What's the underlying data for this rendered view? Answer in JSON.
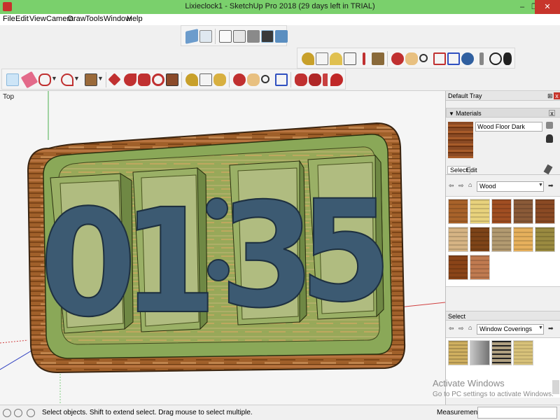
{
  "window": {
    "title": "Lixieclock1 - SketchUp Pro 2018 (29 days left in TRIAL)",
    "minimize": "–",
    "restore": "❐",
    "close": "✕"
  },
  "menu": [
    "File",
    "Edit",
    "View",
    "Camera",
    "Draw",
    "Tools",
    "Window",
    "Help"
  ],
  "viewport": {
    "view_label": "Top",
    "model_digits": [
      "0",
      "1",
      ":",
      "3",
      "5"
    ]
  },
  "tray": {
    "title": "Default Tray",
    "pin": "⊞",
    "close": "x",
    "materials": {
      "header": "Materials",
      "current_material": "Wood Floor Dark",
      "tabs": [
        "Select",
        "Edit"
      ],
      "library": "Wood",
      "swatch_colors": [
        "#a8622a",
        "#e8d27c",
        "#a04e22",
        "#8a5a38",
        "#8a4a24",
        "#d6b484",
        "#7e4418",
        "#b29a70",
        "#e6b05c",
        "#9a8a40",
        "#8a4418",
        "#c07a50"
      ]
    },
    "secondary": {
      "header": "Select",
      "library": "Window Coverings",
      "swatch_colors": [
        "#d0b060",
        "#909090",
        "#b0a080",
        "#d8c27a"
      ]
    }
  },
  "status": {
    "hint": "Select objects. Shift to extend select. Drag mouse to select multiple.",
    "measurements_label": "Measurements"
  },
  "watermark": {
    "title": "Activate Windows",
    "subtitle": "Go to PC settings to activate Windows."
  },
  "colors": {
    "titlebar": "#7ad06c",
    "model_green": "#8aa858",
    "digit_blue": "#3c5a72",
    "wood": "#a0602a"
  }
}
